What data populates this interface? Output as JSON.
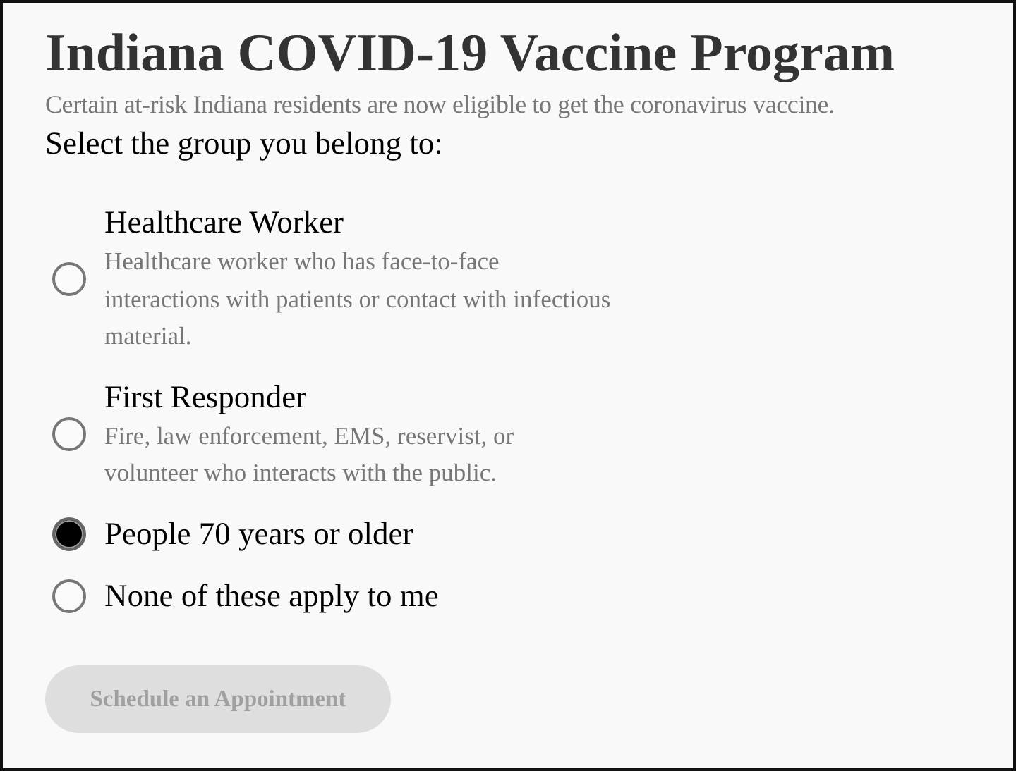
{
  "title": "Indiana COVID-19 Vaccine Program",
  "subtitle": "Certain at-risk Indiana residents are now eligible to get the coronavirus vaccine.",
  "prompt": "Select the group you belong to:",
  "options": [
    {
      "label": "Healthcare Worker",
      "description": "Healthcare worker who has face-to-face interactions with patients or contact with infectious material.",
      "selected": false
    },
    {
      "label": "First Responder",
      "description": "Fire, law enforcement, EMS, reservist, or volunteer who interacts with the public.",
      "selected": false
    },
    {
      "label": "People 70 years or older",
      "selected": true
    },
    {
      "label": "None of these apply to me",
      "selected": false
    }
  ],
  "button": {
    "label": "Schedule an Appointment",
    "disabled": true
  }
}
